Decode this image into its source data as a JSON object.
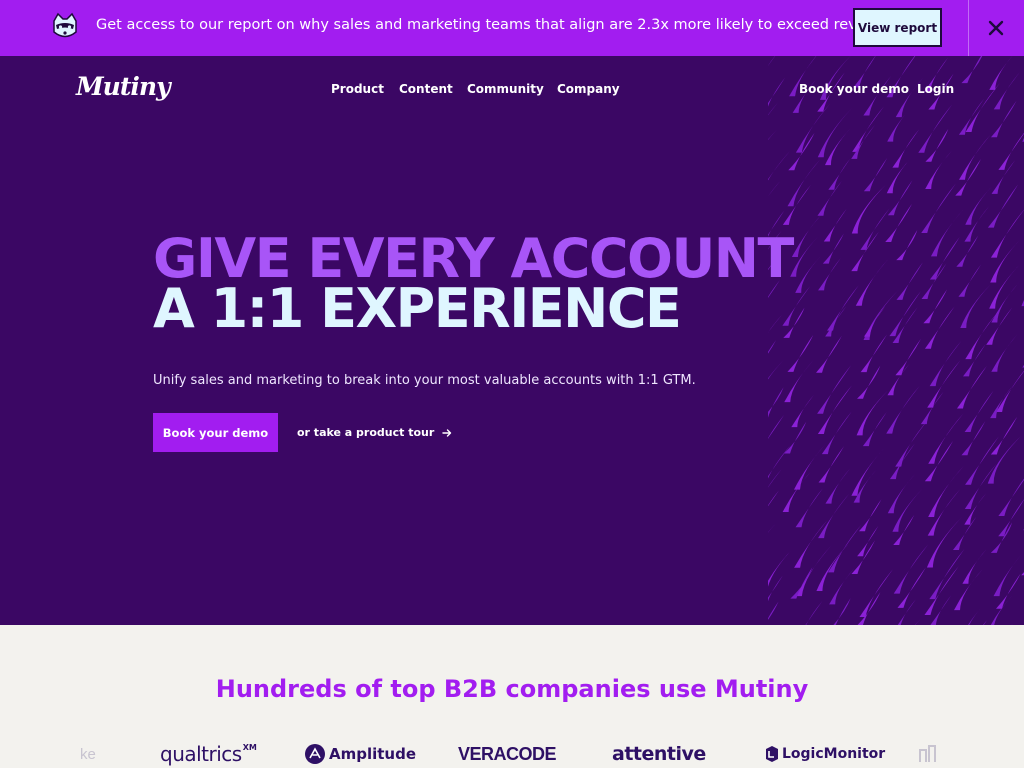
{
  "announcement": {
    "text": "Get access to our report on why sales and marketing teams that align are 2.3x more likely to exceed revenue.",
    "button_label": "View report",
    "close_icon": "close-icon"
  },
  "nav": {
    "logo": "Mutiny",
    "links": [
      "Product",
      "Content",
      "Community",
      "Company"
    ],
    "demo_link": "Book your demo",
    "login_link": "Login"
  },
  "hero": {
    "headline_line1": "GIVE EVERY ACCOUNT",
    "headline_line2": "A 1:1 EXPERIENCE",
    "subheadline": "Unify sales and marketing to break into your most valuable accounts with 1:1 GTM.",
    "primary_cta": "Book your demo",
    "secondary_cta": "or take a product tour"
  },
  "logos_section": {
    "title": "Hundreds of top B2B companies use Mutiny",
    "brands": [
      "qualtrics",
      "XM",
      "Amplitude",
      "VERACODE",
      "attentive",
      "LogicMonitor"
    ],
    "partial_left": "ke"
  },
  "colors": {
    "announcement_bg": "#a21df0",
    "hero_bg": "#3b0764",
    "headline_accent": "#a855f7",
    "headline_light": "#dff6ff",
    "logos_bg": "#f3f2ee"
  }
}
